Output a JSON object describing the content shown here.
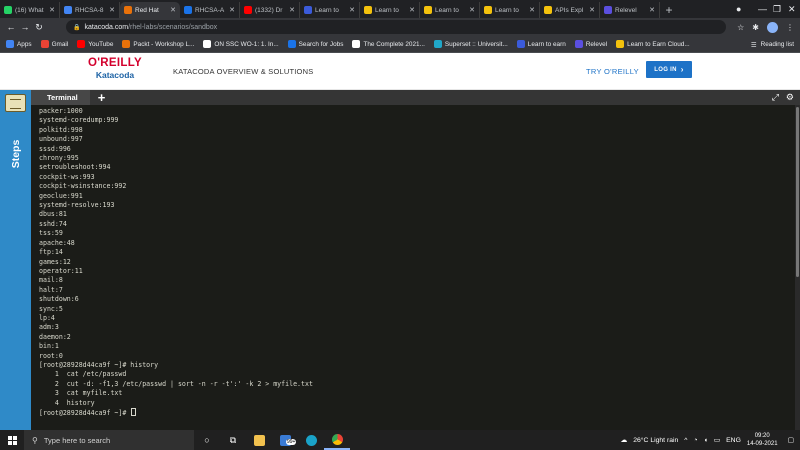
{
  "browser": {
    "tabs": [
      {
        "label": "(16) What",
        "icon": "whatsapp-icon",
        "color": "#25d366",
        "active": false
      },
      {
        "label": "RHCSA-8",
        "icon": "docs-icon",
        "color": "#4285f4",
        "active": false
      },
      {
        "label": "Red Hat",
        "icon": "katacoda-icon",
        "color": "#e8710a",
        "active": true
      },
      {
        "label": "RHCSA-A",
        "icon": "doc-icon",
        "color": "#1a73e8",
        "active": false
      },
      {
        "label": "(1332) Dr",
        "icon": "youtube-icon",
        "color": "#ff0000",
        "active": false
      },
      {
        "label": "Learn to",
        "icon": "learn-icon",
        "color": "#3b5bdb",
        "active": false
      },
      {
        "label": "Learn to",
        "icon": "coin-icon",
        "color": "#f4c20d",
        "active": false
      },
      {
        "label": "Learn to",
        "icon": "coin-icon",
        "color": "#f4c20d",
        "active": false
      },
      {
        "label": "Learn to",
        "icon": "coin-icon",
        "color": "#f4c20d",
        "active": false
      },
      {
        "label": "APIs Expl",
        "icon": "coin-icon",
        "color": "#f4c20d",
        "active": false
      },
      {
        "label": "Relevel",
        "icon": "relevel-icon",
        "color": "#5b4fe0",
        "active": false
      }
    ],
    "url_domain": "katacoda.com",
    "url_path": "/rhel-labs/scenarios/sandbox",
    "bookmarks": [
      {
        "label": "Apps",
        "color": "#4285f4"
      },
      {
        "label": "Gmail",
        "color": "#ea4335"
      },
      {
        "label": "YouTube",
        "color": "#ff0000"
      },
      {
        "label": "Packt - Workshop L...",
        "color": "#e8710a"
      },
      {
        "label": "ON SSC WO-1: 1. In...",
        "color": "#ffffff"
      },
      {
        "label": "Search for Jobs",
        "color": "#1a73e8"
      },
      {
        "label": "The Complete 2021...",
        "color": "#ffffff"
      },
      {
        "label": "Superset :: Universit...",
        "color": "#20a7c9"
      },
      {
        "label": "Learn to earn",
        "color": "#3b5bdb"
      },
      {
        "label": "Relevel",
        "color": "#5b4fe0"
      },
      {
        "label": "Learn to Earn Cloud...",
        "color": "#f4c20d"
      }
    ],
    "reading_list": "Reading list"
  },
  "header": {
    "logo_top": "O'REILLY",
    "logo_bottom": "Katacoda",
    "nav_label": "KATACODA OVERVIEW & SOLUTIONS",
    "try_label": "TRY O'REILLY",
    "login_label": "LOG IN"
  },
  "sidebar": {
    "label": "Steps"
  },
  "terminal": {
    "tab_label": "Terminal",
    "lines": [
      "packer:1000",
      "systemd-coredump:999",
      "polkitd:998",
      "unbound:997",
      "sssd:996",
      "chrony:995",
      "setroubleshoot:994",
      "cockpit-ws:993",
      "cockpit-wsinstance:992",
      "geoclue:991",
      "systemd-resolve:193",
      "dbus:81",
      "sshd:74",
      "tss:59",
      "apache:48",
      "ftp:14",
      "games:12",
      "operator:11",
      "mail:8",
      "halt:7",
      "shutdown:6",
      "sync:5",
      "lp:4",
      "adm:3",
      "daemon:2",
      "bin:1",
      "root:0",
      "[root@28928d44ca9f ~]# history",
      "    1  cat /etc/passwd",
      "    2  cut -d: -f1,3 /etc/passwd | sort -n -r -t':' -k 2 > myfile.txt",
      "    3  cat myfile.txt",
      "    4  history"
    ],
    "prompt": "[root@28928d44ca9f ~]# "
  },
  "taskbar": {
    "search_placeholder": "Type here to search",
    "weather": "26°C  Light rain",
    "language": "ENG",
    "time": "09:20",
    "date": "14-09-2021",
    "badge": "99+"
  },
  "colors": {
    "accent_blue": "#1d72c7",
    "oreilly_red": "#d3002d",
    "steps_blue": "#2f8ac8",
    "terminal_bg": "#1b1c18"
  }
}
